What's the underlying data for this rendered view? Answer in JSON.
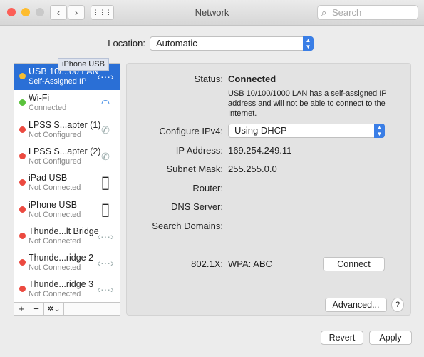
{
  "window": {
    "title": "Network",
    "search_placeholder": "Search",
    "back": "‹",
    "forward": "›",
    "grid": "⋮⋮⋮"
  },
  "location": {
    "label": "Location:",
    "value": "Automatic"
  },
  "tooltip": "iPhone USB",
  "services": [
    {
      "name": "USB 10/...00 LAN",
      "status": "Self-Assigned IP",
      "dot": "#f5bd31",
      "icon": "ethernet-icon",
      "glyph": "‹···›",
      "selected": true
    },
    {
      "name": "Wi-Fi",
      "status": "Connected",
      "dot": "#5ac23c",
      "icon": "wifi-icon",
      "glyph": "◠"
    },
    {
      "name": "LPSS S...apter (1)",
      "status": "Not Configured",
      "dot": "#ec4a40",
      "icon": "phone-icon",
      "glyph": "✆"
    },
    {
      "name": "LPSS S...apter (2)",
      "status": "Not Configured",
      "dot": "#ec4a40",
      "icon": "phone-icon",
      "glyph": "✆"
    },
    {
      "name": "iPad USB",
      "status": "Not Connected",
      "dot": "#ec4a40",
      "icon": "ipad-icon",
      "glyph": "▯"
    },
    {
      "name": "iPhone USB",
      "status": "Not Connected",
      "dot": "#ec4a40",
      "icon": "iphone-icon",
      "glyph": "▯"
    },
    {
      "name": "Thunde...lt Bridge",
      "status": "Not Connected",
      "dot": "#ec4a40",
      "icon": "ethernet-icon",
      "glyph": "‹···›"
    },
    {
      "name": "Thunde...ridge 2",
      "status": "Not Connected",
      "dot": "#ec4a40",
      "icon": "ethernet-icon",
      "glyph": "‹···›"
    },
    {
      "name": "Thunde...ridge 3",
      "status": "Not Connected",
      "dot": "#ec4a40",
      "icon": "ethernet-icon",
      "glyph": "‹···›"
    }
  ],
  "toolbar": {
    "add": "+",
    "remove": "−",
    "gear": "✲⌄"
  },
  "detail": {
    "status_label": "Status:",
    "status_value": "Connected",
    "status_desc": "USB 10/100/1000 LAN has a self-assigned IP address and will not be able to connect to the Internet.",
    "configure_label": "Configure IPv4:",
    "configure_value": "Using DHCP",
    "ip_label": "IP Address:",
    "ip_value": "169.254.249.11",
    "subnet_label": "Subnet Mask:",
    "subnet_value": "255.255.0.0",
    "router_label": "Router:",
    "dns_label": "DNS Server:",
    "search_label": "Search Domains:",
    "x8021_label": "802.1X:",
    "x8021_value": "WPA: ABC",
    "connect": "Connect",
    "advanced": "Advanced...",
    "help": "?"
  },
  "buttons": {
    "revert": "Revert",
    "apply": "Apply"
  }
}
